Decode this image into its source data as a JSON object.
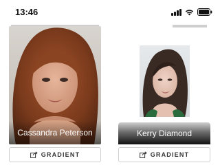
{
  "status_bar": {
    "time": "13:46"
  },
  "cards": [
    {
      "name": "Cassandra Peterson",
      "button_label": "GRADIENT",
      "icon": "share-icon"
    },
    {
      "name": "Kerry Diamond",
      "button_label": "GRADIENT",
      "icon": "share-icon"
    }
  ]
}
